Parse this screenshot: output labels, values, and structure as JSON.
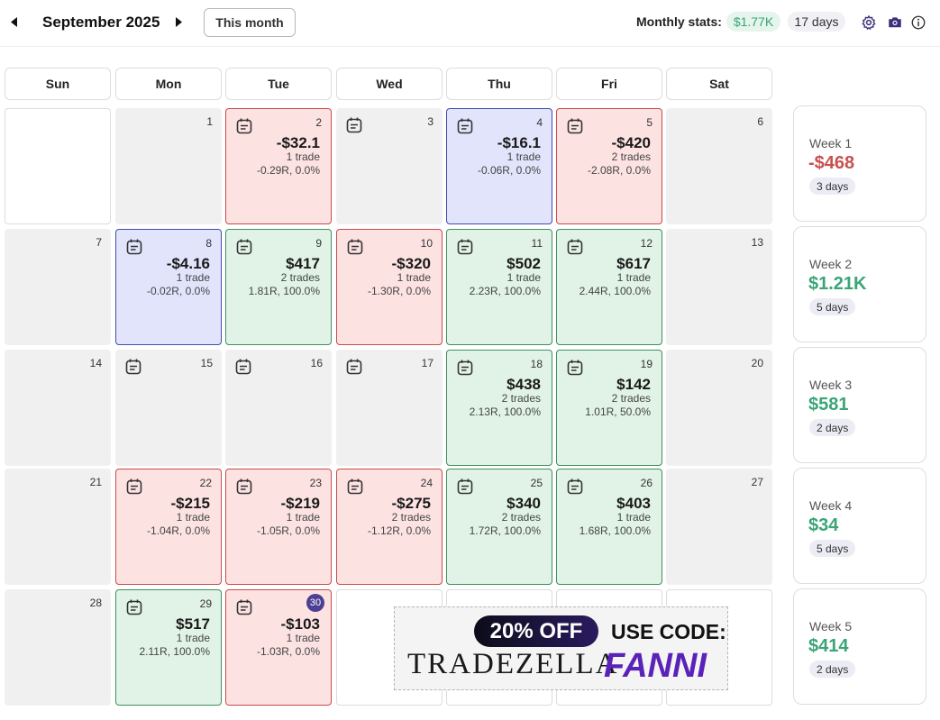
{
  "header": {
    "month_title": "September 2025",
    "this_month_label": "This month",
    "stats_label": "Monthly stats:",
    "stats_pnl": "$1.77K",
    "stats_days": "17 days"
  },
  "day_headers": [
    "Sun",
    "Mon",
    "Tue",
    "Wed",
    "Thu",
    "Fri",
    "Sat"
  ],
  "days": {
    "d1": {
      "num": "1"
    },
    "d2": {
      "num": "2",
      "pnl": "-$32.1",
      "trades": "1 trade",
      "r": "-0.29R, 0.0%"
    },
    "d3": {
      "num": "3"
    },
    "d4": {
      "num": "4",
      "pnl": "-$16.1",
      "trades": "1 trade",
      "r": "-0.06R, 0.0%"
    },
    "d5": {
      "num": "5",
      "pnl": "-$420",
      "trades": "2 trades",
      "r": "-2.08R, 0.0%"
    },
    "d6": {
      "num": "6"
    },
    "d7": {
      "num": "7"
    },
    "d8": {
      "num": "8",
      "pnl": "-$4.16",
      "trades": "1 trade",
      "r": "-0.02R, 0.0%"
    },
    "d9": {
      "num": "9",
      "pnl": "$417",
      "trades": "2 trades",
      "r": "1.81R, 100.0%"
    },
    "d10": {
      "num": "10",
      "pnl": "-$320",
      "trades": "1 trade",
      "r": "-1.30R, 0.0%"
    },
    "d11": {
      "num": "11",
      "pnl": "$502",
      "trades": "1 trade",
      "r": "2.23R, 100.0%"
    },
    "d12": {
      "num": "12",
      "pnl": "$617",
      "trades": "1 trade",
      "r": "2.44R, 100.0%"
    },
    "d13": {
      "num": "13"
    },
    "d14": {
      "num": "14"
    },
    "d15": {
      "num": "15"
    },
    "d16": {
      "num": "16"
    },
    "d17": {
      "num": "17"
    },
    "d18": {
      "num": "18",
      "pnl": "$438",
      "trades": "2 trades",
      "r": "2.13R, 100.0%"
    },
    "d19": {
      "num": "19",
      "pnl": "$142",
      "trades": "2 trades",
      "r": "1.01R, 50.0%"
    },
    "d20": {
      "num": "20"
    },
    "d21": {
      "num": "21"
    },
    "d22": {
      "num": "22",
      "pnl": "-$215",
      "trades": "1 trade",
      "r": "-1.04R, 0.0%"
    },
    "d23": {
      "num": "23",
      "pnl": "-$219",
      "trades": "1 trade",
      "r": "-1.05R, 0.0%"
    },
    "d24": {
      "num": "24",
      "pnl": "-$275",
      "trades": "2 trades",
      "r": "-1.12R, 0.0%"
    },
    "d25": {
      "num": "25",
      "pnl": "$340",
      "trades": "2 trades",
      "r": "1.72R, 100.0%"
    },
    "d26": {
      "num": "26",
      "pnl": "$403",
      "trades": "1 trade",
      "r": "1.68R, 100.0%"
    },
    "d27": {
      "num": "27"
    },
    "d28": {
      "num": "28"
    },
    "d29": {
      "num": "29",
      "pnl": "$517",
      "trades": "1 trade",
      "r": "2.11R, 100.0%"
    },
    "d30": {
      "num": "30",
      "pnl": "-$103",
      "trades": "1 trade",
      "r": "-1.03R, 0.0%"
    }
  },
  "weeks": [
    {
      "label": "Week 1",
      "pnl": "-$468",
      "days": "3 days"
    },
    {
      "label": "Week 2",
      "pnl": "$1.21K",
      "days": "5 days"
    },
    {
      "label": "Week 3",
      "pnl": "$581",
      "days": "2 days"
    },
    {
      "label": "Week 4",
      "pnl": "$34",
      "days": "5 days"
    },
    {
      "label": "Week 5",
      "pnl": "$414",
      "days": "2 days"
    }
  ],
  "ad": {
    "discount": "20% OFF",
    "code_label": "USE CODE:",
    "brand": "TRADEZELLA",
    "code": "FANNI"
  },
  "colors": {
    "profit": "#3aa577",
    "loss": "#c85050",
    "loss_cell_bg": "#fde2e2",
    "win_cell_bg": "#e1f3e6",
    "flat_cell_bg": "#e2e4fc",
    "today_badge": "#4d3f93"
  },
  "icons": [
    "chevron-left-icon",
    "chevron-right-icon",
    "gear-icon",
    "camera-icon",
    "info-icon",
    "journal-note-icon"
  ]
}
